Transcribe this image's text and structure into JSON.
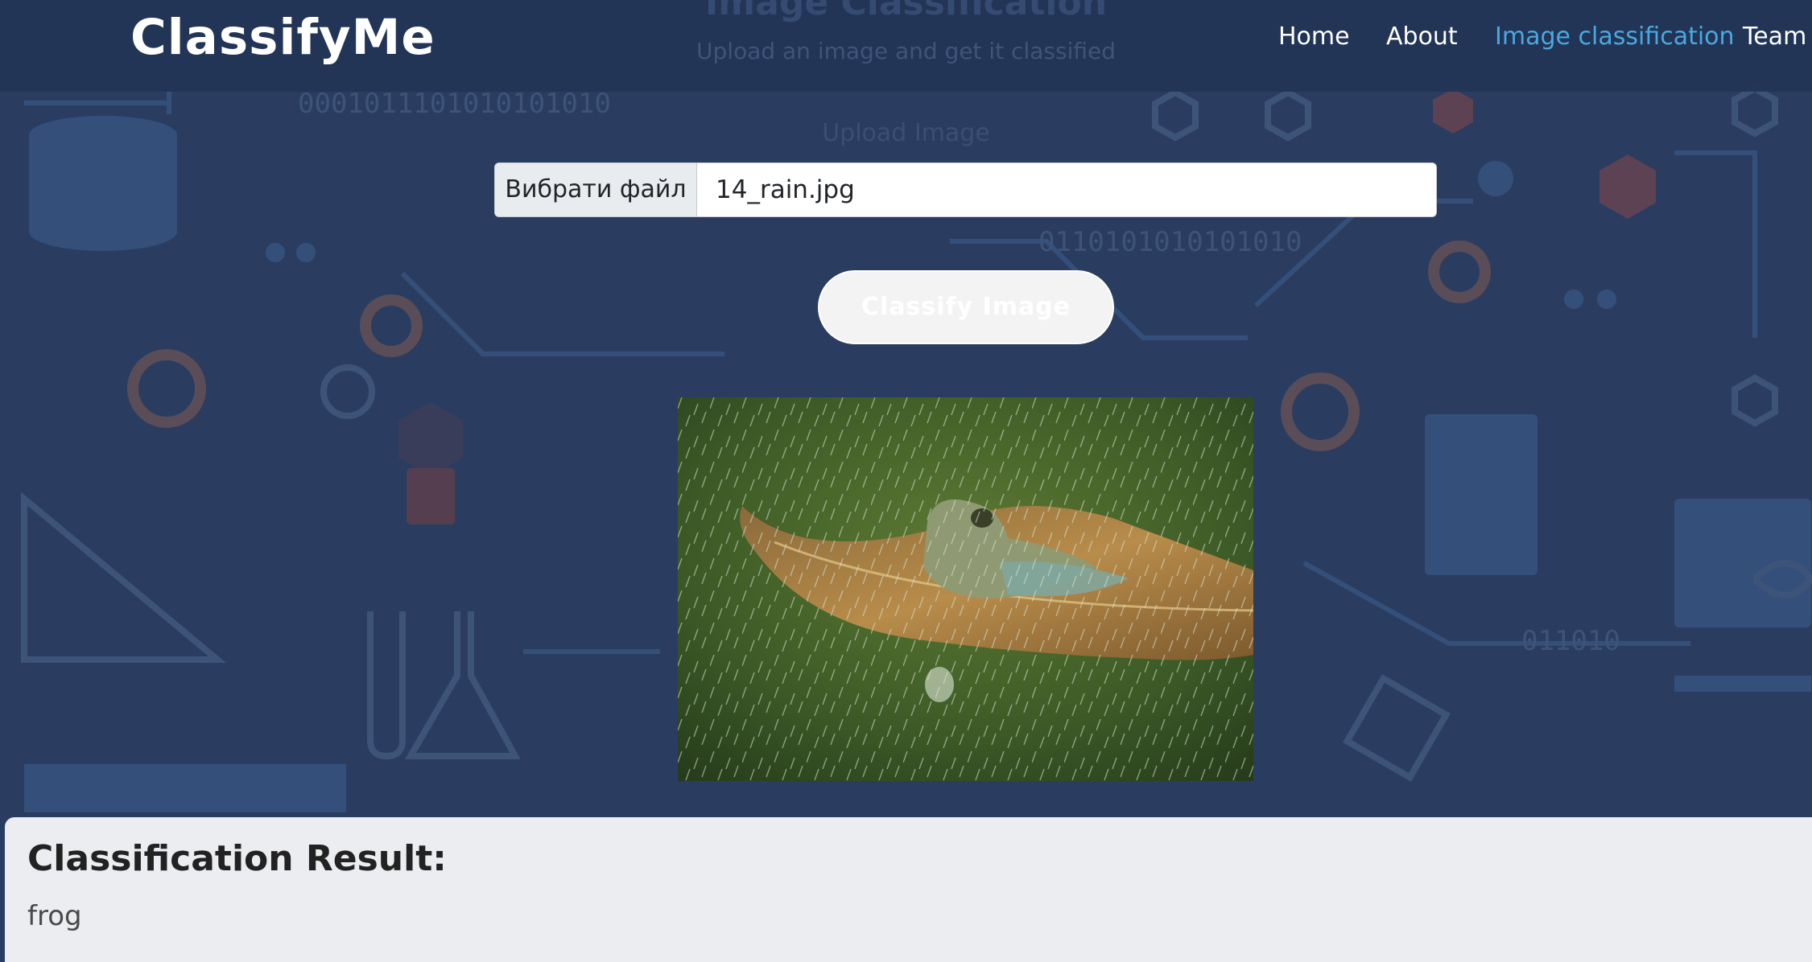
{
  "brand": "ClassifyMe",
  "page_title": "Image Classification",
  "page_subtitle": "Upload an image and get it classified",
  "nav": [
    {
      "label": "Home"
    },
    {
      "label": "About"
    },
    {
      "label": "Image classification"
    },
    {
      "label": "Team"
    }
  ],
  "upload": {
    "label": "Upload Image",
    "choose_button": "Вибрати файл",
    "file_name": "14_rain.jpg"
  },
  "classify_button": "Classify Image",
  "result": {
    "title": "Classification Result:",
    "value": "frog"
  },
  "colors": {
    "background": "#2a3d61",
    "nav_active": "#4aa8e0",
    "result_panel": "#ecedf1"
  }
}
